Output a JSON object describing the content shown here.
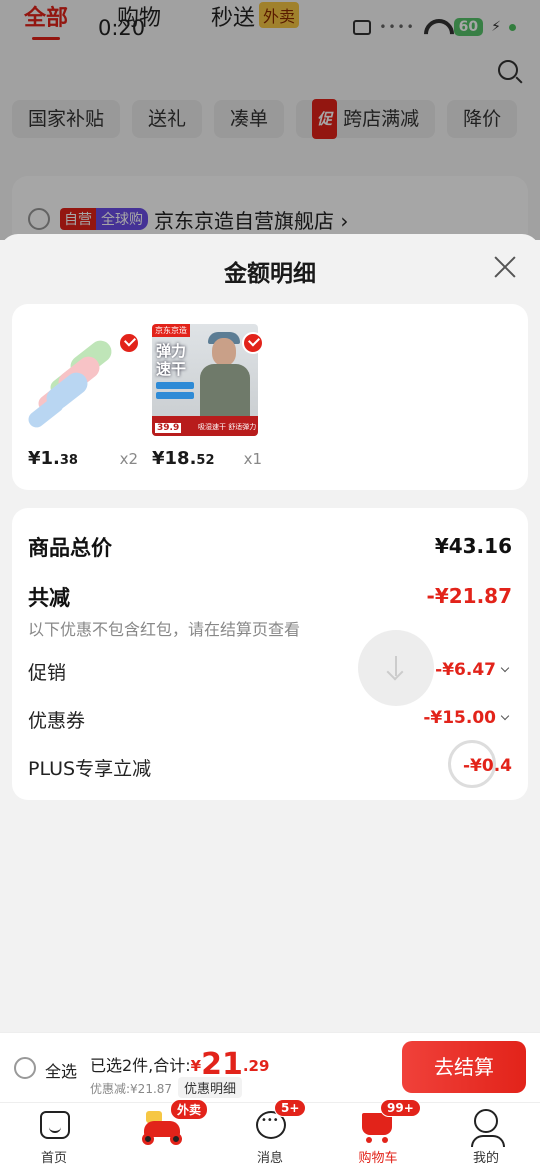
{
  "status_bar": {
    "time": "0:20",
    "battery": "60"
  },
  "top_tabs": [
    {
      "label": "全部",
      "active": true
    },
    {
      "label": "购物",
      "active": false
    },
    {
      "label": "秒送",
      "badge": "外卖",
      "active": false
    }
  ],
  "filters": [
    "国家补贴",
    "送礼",
    "凑单",
    "跨店满减",
    "降价"
  ],
  "filter_promo_icon": "促",
  "shop": {
    "tag1": "自营",
    "tag2": "全球购",
    "name": "京东京造自营旗舰店 ›"
  },
  "sheet": {
    "title": "金额明细"
  },
  "products": [
    {
      "price_int": "¥1.",
      "price_dec": "38",
      "qty": "x2",
      "image_icon": "brush-product-image",
      "checked": true
    },
    {
      "price_int": "¥18.",
      "price_dec": "52",
      "qty": "x1",
      "image_icon": "tshirt-product-image",
      "checked": true,
      "image_text": {
        "brand": "京东京造",
        "title": "弹力速干",
        "price": "39.9",
        "tag": "吸湿速干 舒适弹力"
      }
    }
  ],
  "detail": {
    "total_label": "商品总价",
    "total_value": "¥43.16",
    "reduce_label": "共减",
    "reduce_value": "-¥21.87",
    "note": "以下优惠不包含红包，请在结算页查看",
    "rows": [
      {
        "label": "促销",
        "value": "-¥6.47"
      },
      {
        "label": "优惠券",
        "value": "-¥15.00"
      },
      {
        "label": "PLUS专享立减",
        "value": "-¥0.4"
      }
    ]
  },
  "checkout": {
    "select_all": "全选",
    "selected_text": "已选2件,合计:",
    "yen": "¥",
    "total_int": "21",
    "total_dec": ".29",
    "discount_text": "优惠减:¥21.87",
    "detail_button": "优惠明细",
    "submit": "去结算"
  },
  "nav": [
    {
      "label": "首页",
      "icon": "home-icon"
    },
    {
      "label": "",
      "icon": "delivery-scooter-icon",
      "badge": "外卖"
    },
    {
      "label": "消息",
      "icon": "message-icon",
      "badge": "5+"
    },
    {
      "label": "购物车",
      "icon": "cart-icon",
      "badge": "99+",
      "active": true
    },
    {
      "label": "我的",
      "icon": "profile-icon"
    }
  ],
  "colors": {
    "accent": "#e2231a",
    "background": "#f2f2f2"
  }
}
